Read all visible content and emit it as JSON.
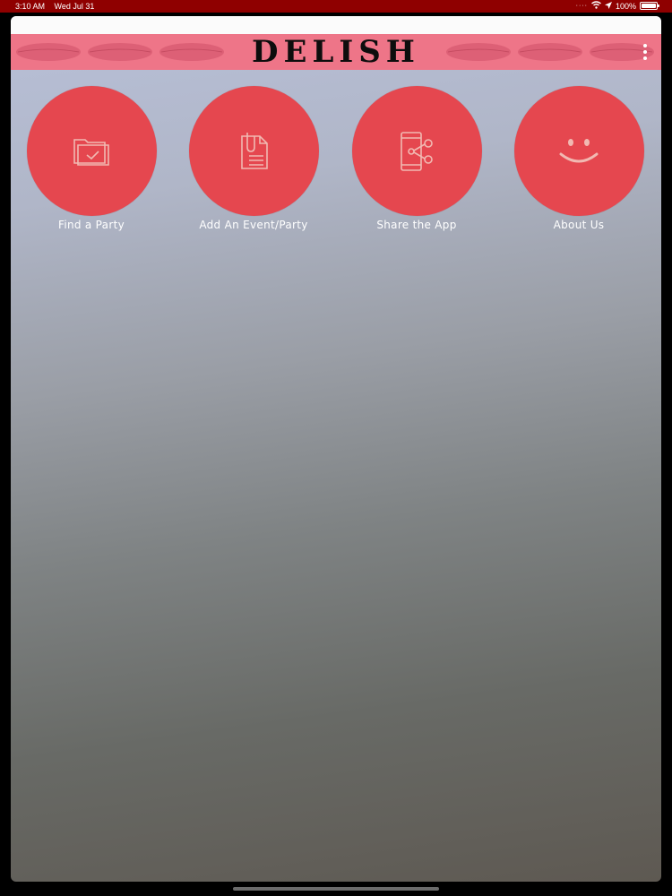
{
  "status_bar": {
    "time": "3:10 AM",
    "date": "Wed Jul 31",
    "battery_percent": "100%",
    "battery_level": 1.0,
    "icons": [
      "signal-dots-icon",
      "wifi-icon",
      "location-arrow-icon",
      "battery-icon"
    ]
  },
  "header": {
    "brand": "DELISH",
    "background_color": "#ee7588",
    "decoration": "lips-pattern",
    "menu_icon": "more-vertical-icon"
  },
  "tiles": [
    {
      "label": "Find a Party",
      "icon": "folder-check-icon"
    },
    {
      "label": "Add An Event/Party",
      "icon": "document-clip-icon"
    },
    {
      "label": "Share the App",
      "icon": "phone-share-icon"
    },
    {
      "label": "About Us",
      "icon": "smiley-icon"
    }
  ],
  "colors": {
    "status_bar": "#8f0000",
    "tile_circle": "#e5474f",
    "icon_stroke": "#f1b9b2"
  }
}
